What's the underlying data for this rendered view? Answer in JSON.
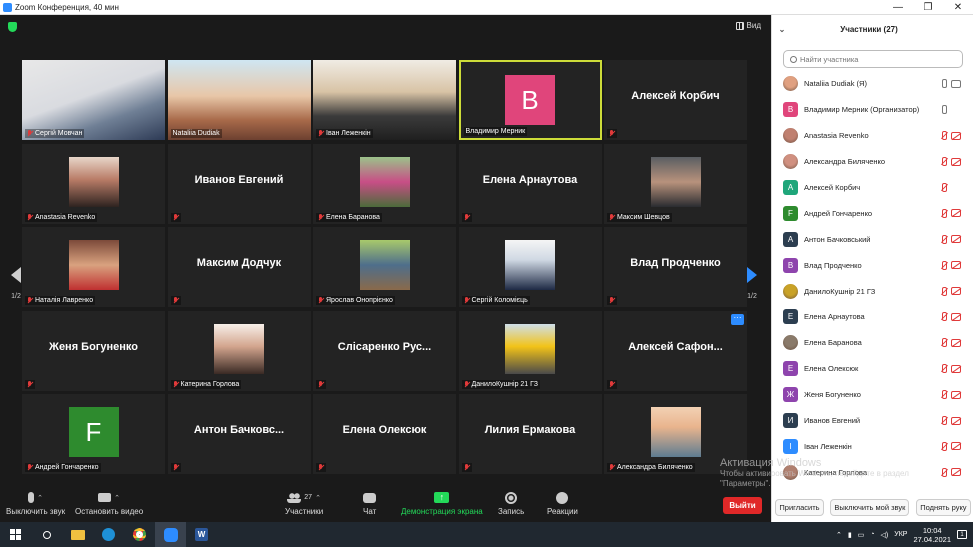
{
  "window": {
    "title": "Zoom Конференция, 40 мин"
  },
  "view_label": "Вид",
  "pager": {
    "left": "1/2",
    "right": "1/2"
  },
  "tiles": [
    {
      "label": "Сергій Мовчан",
      "kind": "photo",
      "photo": "p1"
    },
    {
      "label": "Nataliia Dudiak",
      "kind": "photo",
      "photo": "p2",
      "nomute": true
    },
    {
      "label": "Іван Леженкін",
      "kind": "photo",
      "photo": "p3"
    },
    {
      "label": "Владимир Мерник",
      "kind": "avatar",
      "initial": "В",
      "color": "#e0457b",
      "active": true,
      "nomute": true
    },
    {
      "name": "Алексей Корбич",
      "kind": "name"
    },
    {
      "label": "Anastasia Revenko",
      "kind": "thumb",
      "photo": "p4"
    },
    {
      "name": "Иванов Евгений",
      "kind": "name"
    },
    {
      "label": "Елена Баранова",
      "kind": "thumb",
      "photo": "p5"
    },
    {
      "name": "Елена Арнаутова",
      "kind": "name"
    },
    {
      "label": "Максим Шевцов",
      "kind": "thumb",
      "photo": "p6"
    },
    {
      "label": "Наталія Лавренко",
      "kind": "thumb",
      "photo": "p7"
    },
    {
      "name": "Максим Додчук",
      "kind": "name"
    },
    {
      "label": "Ярослав Онопрієнко",
      "kind": "thumb",
      "photo": "p8"
    },
    {
      "label": "Сергій Коломієць",
      "kind": "thumb",
      "photo": "p9"
    },
    {
      "name": "Влад Продченко",
      "kind": "name"
    },
    {
      "name": "Женя Богуненко",
      "kind": "name"
    },
    {
      "label": "Катерина Горлова",
      "kind": "thumb",
      "photo": "p10"
    },
    {
      "name": "Слісаренко Рус...",
      "kind": "name"
    },
    {
      "label": "ДанилоКушнір 21 ГЗ",
      "kind": "thumb",
      "photo": "p11"
    },
    {
      "name": "Алексей Сафон...",
      "kind": "name",
      "more": true
    },
    {
      "label": "Андрей Гончаренко",
      "kind": "avatar",
      "initial": "F",
      "color": "#2e8b2e"
    },
    {
      "name": "Антон Бачковс...",
      "kind": "name"
    },
    {
      "name": "Елена Олексюк",
      "kind": "name"
    },
    {
      "name": "Лилия Ермакова",
      "kind": "name"
    },
    {
      "label": "Александра Биляченко",
      "kind": "thumb",
      "photo": "p12"
    }
  ],
  "toolbar": {
    "mute": "Выключить звук",
    "video": "Остановить видео",
    "participants": "Участники",
    "participants_count": "27",
    "chat": "Чат",
    "share": "Демонстрация экрана",
    "record": "Запись",
    "reactions": "Реакции",
    "end": "Выйти"
  },
  "watermark": {
    "title": "Активация Windows",
    "line1": "Чтобы активировать Windows, перейдите в раздел",
    "line2": "\"Параметры\"."
  },
  "panel": {
    "title": "Участники (27)",
    "search_placeholder": "Найти участника",
    "participants": [
      {
        "name": "Nataliia Dudiak (Я)",
        "avatar": "photo",
        "color": "#e0a080",
        "mic": "on",
        "cam": "on"
      },
      {
        "name": "Владимир Мерник (Организатор)",
        "avatar": "В",
        "color": "#e0457b",
        "mic": "on",
        "cam": "none"
      },
      {
        "name": "Anastasia Revenko",
        "avatar": "photo",
        "color": "#c08070",
        "mic": "off",
        "cam": "off"
      },
      {
        "name": "Александра Биляченко",
        "avatar": "photo",
        "color": "#d09080",
        "mic": "off",
        "cam": "off"
      },
      {
        "name": "Алексей Корбич",
        "avatar": "А",
        "color": "#1fa67a",
        "mic": "off",
        "cam": "none"
      },
      {
        "name": "Андрей Гончаренко",
        "avatar": "F",
        "color": "#2e8b2e",
        "mic": "off",
        "cam": "off"
      },
      {
        "name": "Антон Бачковський",
        "avatar": "А",
        "color": "#2c3e50",
        "mic": "off",
        "cam": "off"
      },
      {
        "name": "Влад Продченко",
        "avatar": "В",
        "color": "#8e44ad",
        "mic": "off",
        "cam": "off"
      },
      {
        "name": "ДанилоКушнір 21 ГЗ",
        "avatar": "photo",
        "color": "#c9a227",
        "mic": "off",
        "cam": "off"
      },
      {
        "name": "Елена Арнаутова",
        "avatar": "Е",
        "color": "#2c3e50",
        "mic": "off",
        "cam": "off"
      },
      {
        "name": "Елена Баранова",
        "avatar": "photo",
        "color": "#8a7a6a",
        "mic": "off",
        "cam": "off"
      },
      {
        "name": "Елена Олексюк",
        "avatar": "Е",
        "color": "#8e44ad",
        "mic": "off",
        "cam": "off"
      },
      {
        "name": "Женя Богуненко",
        "avatar": "Ж",
        "color": "#8e44ad",
        "mic": "off",
        "cam": "off"
      },
      {
        "name": "Иванов Евгений",
        "avatar": "И",
        "color": "#2c3e50",
        "mic": "off",
        "cam": "off"
      },
      {
        "name": "Іван Леженкін",
        "avatar": "І",
        "color": "#2d8cff",
        "mic": "off",
        "cam": "off"
      },
      {
        "name": "Катерина Горлова",
        "avatar": "photo",
        "color": "#b08070",
        "mic": "off",
        "cam": "off"
      }
    ],
    "invite": "Пригласить",
    "mute_all": "Выключить мой звук",
    "raise_hand": "Поднять руку"
  },
  "taskbar": {
    "lang": "УКР",
    "time": "10:04",
    "date": "27.04.2021",
    "notif_count": "1"
  }
}
